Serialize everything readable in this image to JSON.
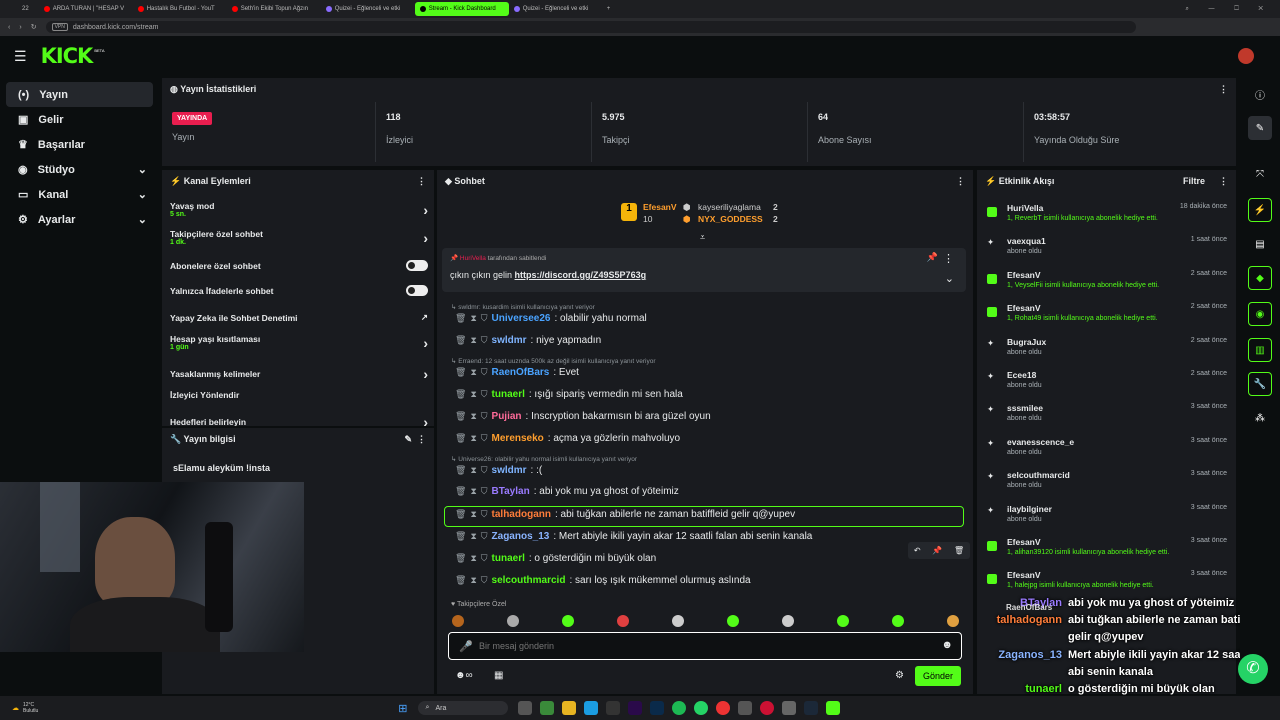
{
  "browser": {
    "tabs": [
      "ARDA TURAN | \"HESAP V",
      "Hastalık Bu Futbol - YouT",
      "Seth'in Ekibi Topun Ağzın",
      "Quizei - Eğlenceli ve etki",
      "Stream - Kick Dashboard",
      "Quizei - Eğlenceli ve etki"
    ],
    "url": "dashboard.kick.com/stream",
    "tab_count": "22"
  },
  "logo": "KICK",
  "logo_badge": "BETA",
  "sidebar": {
    "items": [
      "Yayın",
      "Gelir",
      "Başarılar",
      "Stüdyo",
      "Kanal",
      "Ayarlar"
    ]
  },
  "stats": {
    "title": "Yayın İstatistikleri",
    "live_badge": "YAYINDA",
    "live_label": "Yayın",
    "viewers": "118",
    "viewers_label": "İzleyici",
    "followers": "5.975",
    "followers_label": "Takipçi",
    "subs": "64",
    "subs_label": "Abone Sayısı",
    "uptime": "03:58:57",
    "uptime_label": "Yayında Olduğu Süre"
  },
  "actions": {
    "title": "Kanal Eylemleri",
    "items": [
      {
        "label": "Yavaş mod",
        "sub": "5 sn."
      },
      {
        "label": "Takipçilere özel sohbet",
        "sub": "1 dk."
      },
      {
        "label": "Abonelere özel sohbet"
      },
      {
        "label": "Yalnızca İfadelerle sohbet"
      },
      {
        "label": "Yapay Zeka ile Sohbet Denetimi"
      },
      {
        "label": "Hesap yaşı kısıtlaması",
        "sub": "1 gün"
      },
      {
        "label": "Yasaklanmış kelimeler"
      },
      {
        "label": "İzleyici Yönlendir"
      },
      {
        "label": "Hedefleri belirleyin"
      }
    ]
  },
  "info": {
    "title": "Yayın bilgisi",
    "text": "sElamu aleyküm !insta"
  },
  "chat": {
    "title": "Sohbet",
    "top_gifter": "EfesanV",
    "top_gifter_count": "10",
    "gifter2": "kayseriliyaglama",
    "gifter2_count": "2",
    "gifter3": "NYX_GODDESS",
    "gifter3_count": "2",
    "pinned_by": "HuriVella",
    "pinned_suffix": "tarafından sabitlendi",
    "pinned_text": "çıkın çıkın gelin",
    "pinned_link": "https://discord.gg/Z49S5P763g",
    "messages": [
      {
        "reply": "swldmr: kusardim isimli kullanıcıya yanıt veriyor",
        "user": "Universee26",
        "color": "#4aa3ff",
        "text": ": olabilir yahu normal"
      },
      {
        "user": "swldmr",
        "color": "#7fb4ff",
        "text": ": niye yapmadın"
      },
      {
        "reply": "Erraend: 12 saat uuznda 500k az değil isimli kullanıcıya yanıt veriyor",
        "user": "RaenOfBars",
        "color": "#4aa3ff",
        "text": ": Evet"
      },
      {
        "user": "tunaerl",
        "color": "#53fc18",
        "text": ": ışığı sipariş vermedin mi sen hala"
      },
      {
        "user": "Pujian",
        "color": "#ff6b9a",
        "text": ": Inscryption bakarmısın bi ara güzel oyun"
      },
      {
        "user": "Merenseko",
        "color": "#ff9f2e",
        "text": ": açma ya gözlerin mahvoluyo"
      },
      {
        "reply": "Universe26: olabilir yahu normal isimli kullanıcıya yanıt veriyor",
        "user": "swldmr",
        "color": "#7fb4ff",
        "text": ": :("
      },
      {
        "user": "BTaylan",
        "color": "#9a7bff",
        "text": ": abi yok mu ya ghost of yöteimiz"
      },
      {
        "user": "talhadogann",
        "color": "#ff7d3a",
        "text": ": abi tuğkan abilerle ne zaman batiffleid gelir q@yupev"
      },
      {
        "user": "Zaganos_13",
        "color": "#8ab4ff",
        "text": ": Mert abiyle ikili yayin akar 12 saatli falan abi senin kanala"
      },
      {
        "user": "tunaerl",
        "color": "#53fc18",
        "text": ": o gösterdiğin mi büyük olan"
      },
      {
        "user": "selcouthmarcid",
        "color": "#53fc18",
        "text": ": sarı loş ışık mükemmel olurmuş aslında"
      }
    ],
    "followers_only": "Takipçilere Özel",
    "placeholder": "Bir mesaj gönderin",
    "send": "Gönder"
  },
  "events": {
    "title": "Etkinlik Akışı",
    "filter": "Filtre",
    "items": [
      {
        "name": "HuriVella",
        "desc": "1, ReverbT isimli kullanıcıya abonelik hediye etti.",
        "time": "18 dakika önce",
        "gift": true
      },
      {
        "name": "vaexqua1",
        "desc": "abone oldu",
        "time": "1 saat önce"
      },
      {
        "name": "EfesanV",
        "desc": "1, VeyselFii isimli kullanıcıya abonelik hediye etti.",
        "time": "2 saat önce",
        "gift": true
      },
      {
        "name": "EfesanV",
        "desc": "1, Rohat49 isimli kullanıcıya abonelik hediye etti.",
        "time": "2 saat önce",
        "gift": true
      },
      {
        "name": "BugraJux",
        "desc": "abone oldu",
        "time": "2 saat önce"
      },
      {
        "name": "Ecee18",
        "desc": "abone oldu",
        "time": "2 saat önce"
      },
      {
        "name": "sssmilee",
        "desc": "abone oldu",
        "time": "3 saat önce"
      },
      {
        "name": "evanesscence_e",
        "desc": "abone oldu",
        "time": "3 saat önce"
      },
      {
        "name": "selcouthmarcid",
        "desc": "abone oldu",
        "time": "3 saat önce"
      },
      {
        "name": "ilaybilginer",
        "desc": "abone oldu",
        "time": "3 saat önce"
      },
      {
        "name": "EfesanV",
        "desc": "1, alihan39120 isimli kullanıcıya abonelik hediye etti.",
        "time": "3 saat önce",
        "gift": true
      },
      {
        "name": "EfesanV",
        "desc": "1, halejpg isimli kullanıcıya abonelik hediye etti.",
        "time": "3 saat önce",
        "gift": true
      }
    ]
  },
  "overlay": [
    {
      "user": "BTaylan",
      "color": "#9a7bff",
      "text": "abi yok mu ya ghost of yöteimiz"
    },
    {
      "user": "talhadogann",
      "color": "#ff7d3a",
      "text": "abi tuğkan abilerle ne zaman batiffleid"
    },
    {
      "user": "",
      "text": "gelir q@yupev"
    },
    {
      "user": "Zaganos_13",
      "color": "#8ab4ff",
      "text": "Mert abiyle ikili yayin akar 12 saatli falan"
    },
    {
      "user": "",
      "text": "abi senin kanala"
    },
    {
      "user": "tunaerl",
      "color": "#53fc18",
      "text": "o gösterdiğin mi büyük olan"
    },
    {
      "user": "selcouthmarcid",
      "color": "#53fc18",
      "text": "sarı loş ışık mükemmel olurmuş aslında"
    }
  ],
  "overlay_extra": "RaenOfBars",
  "taskbar": {
    "weather": "12°C",
    "weather_sub": "Bulutlu",
    "search": "Ara"
  },
  "colors": {
    "accent": "#53fc18",
    "live": "#e91e4f",
    "panel": "#191b1f"
  }
}
